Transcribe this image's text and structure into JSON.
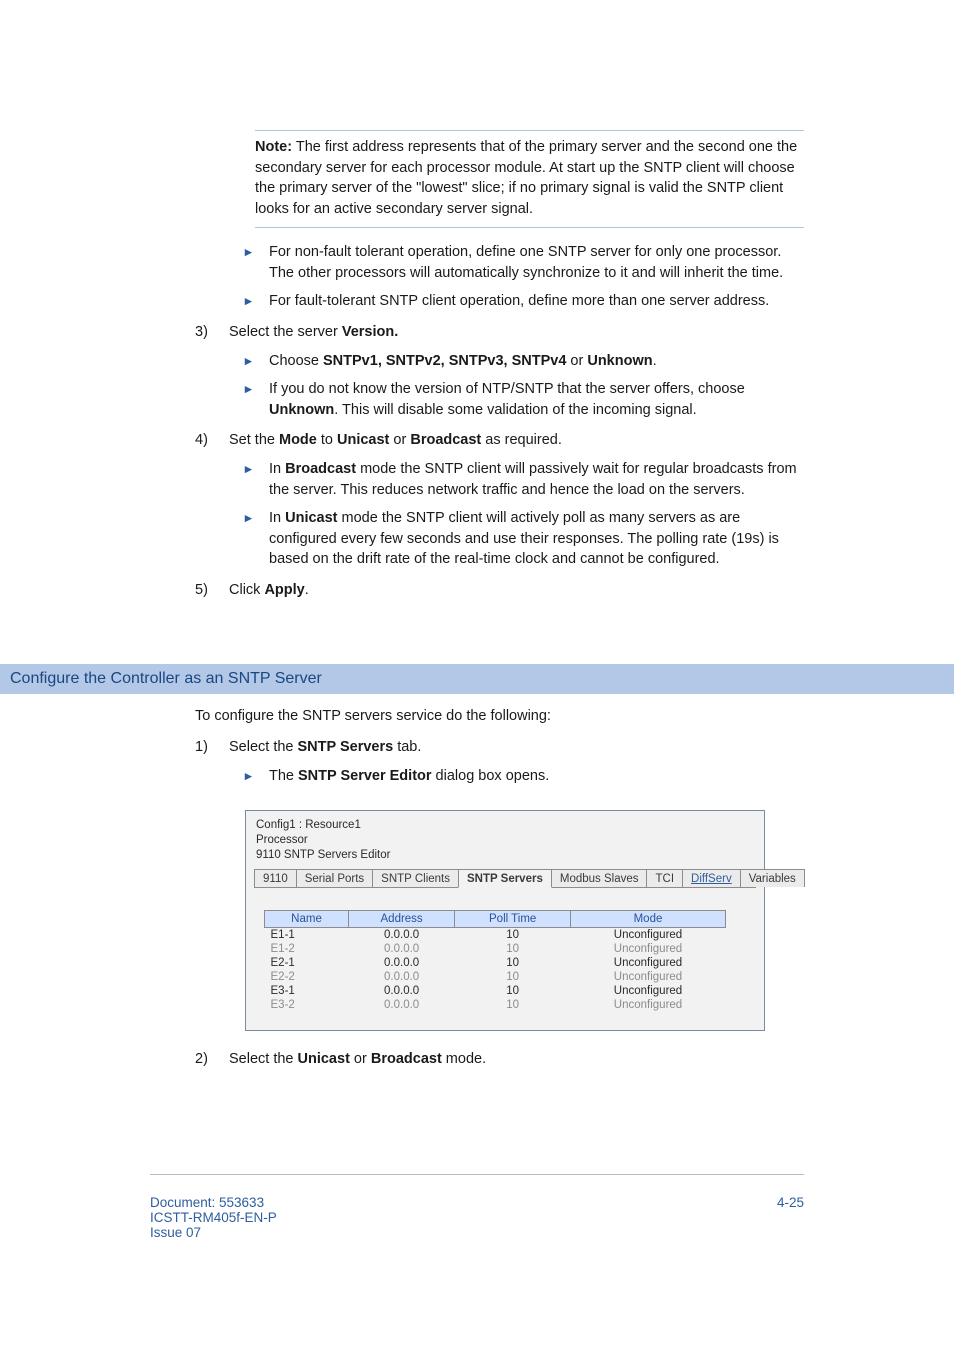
{
  "note": {
    "label": "Note:",
    "text": "The first address represents that of the primary server and the second one the secondary server for each processor module. At start up the SNTP client will choose the primary server of the \"lowest\" slice; if no primary signal is valid the SNTP client looks for an active secondary server signal."
  },
  "bullets_pre": [
    "For non-fault tolerant operation, define one SNTP server for only one processor. The other processors will automatically synchronize to it and will inherit the time.",
    "For fault-tolerant SNTP client operation, define more than one server address."
  ],
  "step3": {
    "num": "3)",
    "text_prefix": "Select the server ",
    "text_bold": "Version.",
    "sub": [
      {
        "prefix": "Choose ",
        "bold": "SNTPv1, SNTPv2, SNTPv3, SNTPv4",
        "mid": " or ",
        "bold2": "Unknown",
        "suffix": "."
      },
      {
        "prefix": "If you do not know the version of NTP/SNTP that the server offers, choose ",
        "bold": "Unknown",
        "suffix": ". This will disable some validation of the incoming signal."
      }
    ]
  },
  "step4": {
    "num": "4)",
    "text_prefix": "Set the ",
    "bold1": "Mode",
    "mid1": " to ",
    "bold2": "Unicast",
    "mid2": " or ",
    "bold3": "Broadcast",
    "suffix": " as required.",
    "sub": [
      {
        "prefix": "In ",
        "bold": "Broadcast",
        "suffix": " mode the SNTP client will passively wait for regular broadcasts from the server. This reduces network traffic and hence the load on the servers."
      },
      {
        "prefix": "In ",
        "bold": "Unicast",
        "suffix": " mode the SNTP client will actively poll as many servers as are configured every few seconds and use their responses. The polling rate (19s) is based on the drift rate of the real-time clock and cannot be configured."
      }
    ]
  },
  "step5": {
    "num": "5)",
    "text_prefix": "Click ",
    "bold": "Apply",
    "suffix": "."
  },
  "heading": "Configure the Controller as an SNTP Server",
  "intro": "To configure the SNTP servers service do the following:",
  "step1": {
    "num": "1)",
    "text_prefix": "Select the ",
    "bold": "SNTP Servers",
    "suffix": " tab.",
    "sub": {
      "prefix": "The ",
      "bold": "SNTP Server Editor",
      "suffix": " dialog box opens."
    }
  },
  "mock": {
    "title1": "Config1 : Resource1",
    "title2": "Processor",
    "title3": "9110 SNTP Servers Editor",
    "tabs": [
      "9110",
      "Serial Ports",
      "SNTP Clients",
      "SNTP Servers",
      "Modbus Slaves",
      "TCI",
      "DiffServ",
      "Variables"
    ],
    "active_tab_index": 3,
    "headers": [
      "Name",
      "Address",
      "Poll Time",
      "Mode"
    ],
    "rows": [
      {
        "name": "E1-1",
        "addr": "0.0.0.0",
        "poll": "10",
        "mode": "Unconfigured",
        "dim": false
      },
      {
        "name": "E1-2",
        "addr": "0.0.0.0",
        "poll": "10",
        "mode": "Unconfigured",
        "dim": true
      },
      {
        "name": "E2-1",
        "addr": "0.0.0.0",
        "poll": "10",
        "mode": "Unconfigured",
        "dim": false
      },
      {
        "name": "E2-2",
        "addr": "0.0.0.0",
        "poll": "10",
        "mode": "Unconfigured",
        "dim": true
      },
      {
        "name": "E3-1",
        "addr": "0.0.0.0",
        "poll": "10",
        "mode": "Unconfigured",
        "dim": false
      },
      {
        "name": "E3-2",
        "addr": "0.0.0.0",
        "poll": "10",
        "mode": "Unconfigured",
        "dim": true
      }
    ]
  },
  "step2b": {
    "num": "2)",
    "text_prefix": "Select the ",
    "bold1": "Unicast",
    "mid": " or ",
    "bold2": "Broadcast",
    "suffix": " mode."
  },
  "footer": {
    "doc1": "Document: 553633",
    "doc2": "ICSTT-RM405f-EN-P",
    "doc3": " Issue 07",
    "page": "4-25"
  }
}
